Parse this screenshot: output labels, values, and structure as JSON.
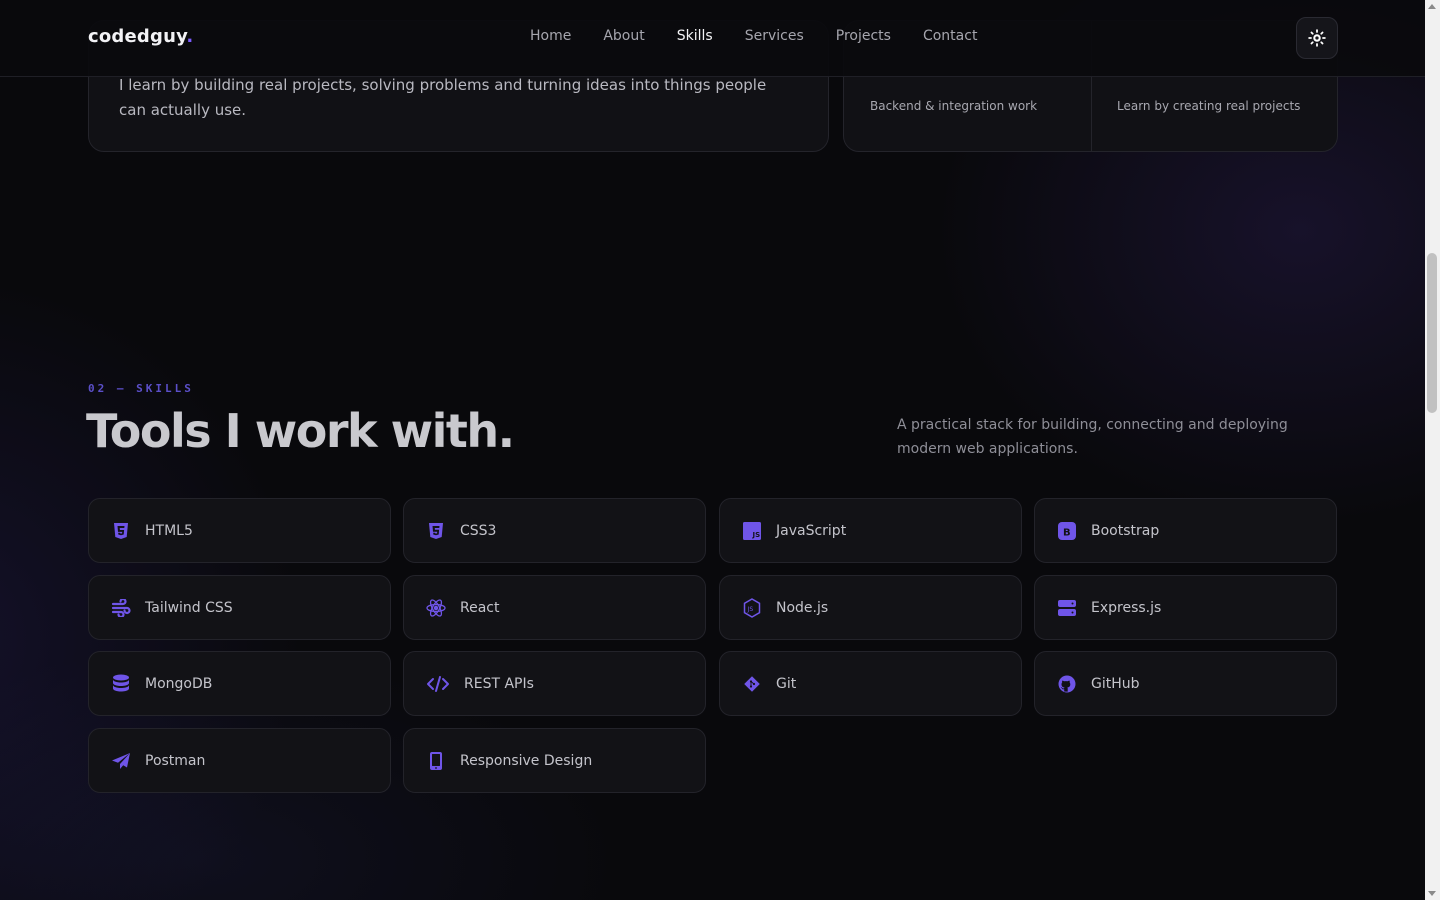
{
  "brand": {
    "name": "codedguy",
    "dot": ".",
    "accent": "#7c5cff"
  },
  "nav": {
    "items": [
      {
        "label": "Home"
      },
      {
        "label": "About"
      },
      {
        "label": "Skills"
      },
      {
        "label": "Services"
      },
      {
        "label": "Projects"
      },
      {
        "label": "Contact"
      }
    ],
    "active": "Skills",
    "theme_toggle_icon": "sun-icon"
  },
  "about": {
    "text": "I learn by building real projects, solving problems and turning ideas into things people can actually use."
  },
  "stats": [
    {
      "caption": "Backend & integration work"
    },
    {
      "caption": "Learn by creating real projects"
    }
  ],
  "skills": {
    "eyebrow": "02 — SKILLS",
    "title": "Tools I work with.",
    "description": "A practical stack for building, connecting and deploying modern web applications.",
    "items": [
      {
        "label": "HTML5",
        "icon": "html5-icon"
      },
      {
        "label": "CSS3",
        "icon": "css3-icon"
      },
      {
        "label": "JavaScript",
        "icon": "javascript-icon"
      },
      {
        "label": "Bootstrap",
        "icon": "bootstrap-icon"
      },
      {
        "label": "Tailwind CSS",
        "icon": "wind-icon"
      },
      {
        "label": "React",
        "icon": "react-icon"
      },
      {
        "label": "Node.js",
        "icon": "nodejs-icon"
      },
      {
        "label": "Express.js",
        "icon": "server-icon"
      },
      {
        "label": "MongoDB",
        "icon": "database-icon"
      },
      {
        "label": "REST APIs",
        "icon": "code-icon"
      },
      {
        "label": "Git",
        "icon": "git-icon"
      },
      {
        "label": "GitHub",
        "icon": "github-icon"
      },
      {
        "label": "Postman",
        "icon": "paper-plane-icon"
      },
      {
        "label": "Responsive Design",
        "icon": "mobile-icon"
      }
    ]
  },
  "colors": {
    "icon": "#6f55e8",
    "background": "#09090c",
    "card": "#121216"
  }
}
